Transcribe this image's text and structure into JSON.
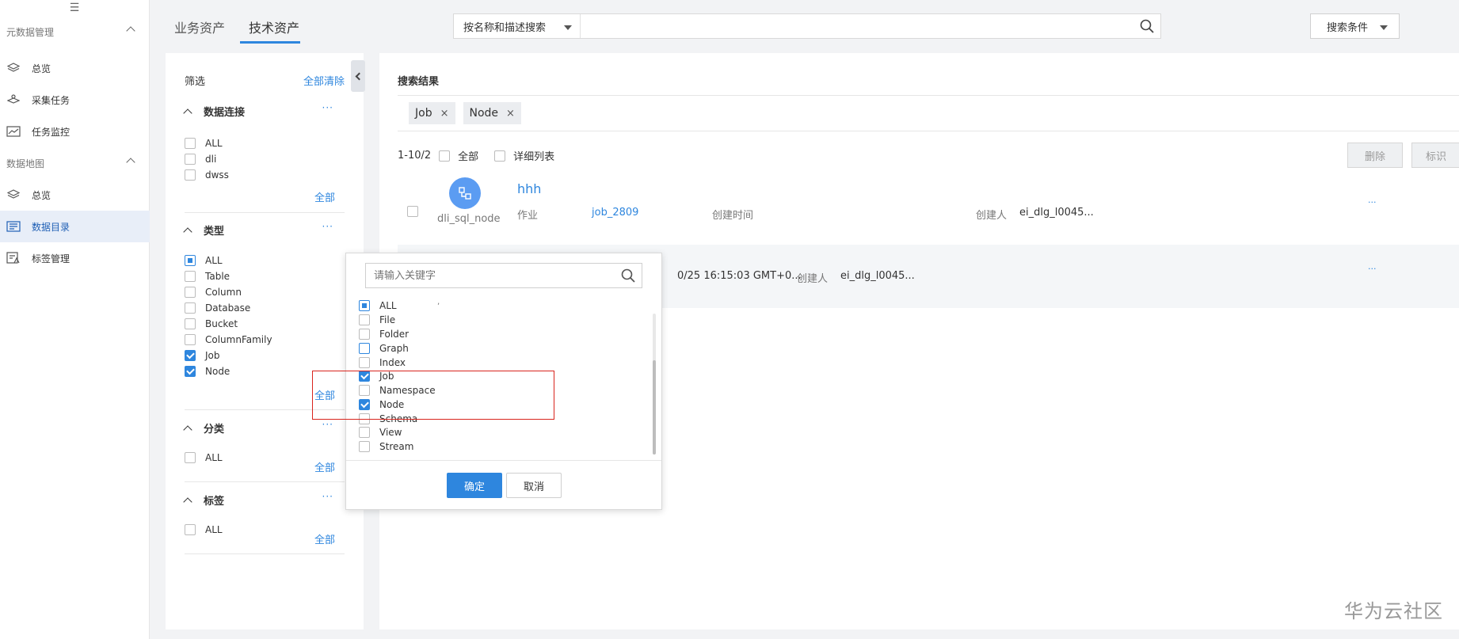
{
  "sidebar": {
    "groups": [
      {
        "label": "元数据管理",
        "items": [
          {
            "label": "总览",
            "icon": "layers-icon"
          },
          {
            "label": "采集任务",
            "icon": "collect-icon"
          },
          {
            "label": "任务监控",
            "icon": "chart-line-icon"
          }
        ]
      },
      {
        "label": "数据地图",
        "items": [
          {
            "label": "总览",
            "icon": "layers-icon"
          },
          {
            "label": "数据目录",
            "icon": "catalog-icon",
            "active": true
          },
          {
            "label": "标签管理",
            "icon": "tag-manage-icon"
          }
        ]
      }
    ]
  },
  "header": {
    "tabs": [
      "业务资产",
      "技术资产"
    ],
    "active_tab": "技术资产",
    "search_mode": "按名称和描述搜索",
    "search_value": "",
    "cond_label": "搜索条件"
  },
  "filter": {
    "title": "筛选",
    "clear": "全部清除",
    "more": "···",
    "all_label": "全部",
    "sections": {
      "conn": {
        "title": "数据连接",
        "options": [
          "ALL",
          "dli",
          "dwss"
        ]
      },
      "type": {
        "title": "类型",
        "options": [
          "ALL",
          "Table",
          "Column",
          "Database",
          "Bucket",
          "ColumnFamily",
          "Job",
          "Node"
        ]
      },
      "cat": {
        "title": "分类",
        "options": [
          "ALL"
        ]
      },
      "tag": {
        "title": "标签",
        "options": [
          "ALL"
        ]
      }
    }
  },
  "results": {
    "title": "搜索结果",
    "tags": [
      "Job",
      "Node"
    ],
    "tag_close": "×",
    "range": "1-10/2",
    "select_all": "全部",
    "detail_list": "详细列表",
    "delete": "删除",
    "mark": "标识",
    "rows": [
      {
        "name": "hhh",
        "avatar_label": "dli_sql_node",
        "type": "作业",
        "job": "job_2809",
        "created_label": "创建时间",
        "creator_label": "创建人",
        "creator": "ei_dlg_l0045..."
      },
      {
        "created_time": "0/25 16:15:03 GMT+0...",
        "creator_label": "创建人",
        "creator": "ei_dlg_l0045..."
      }
    ],
    "more": "···",
    "tick": ","
  },
  "popup": {
    "placeholder": "请输入关键字",
    "items": [
      {
        "label": "ALL",
        "state": "partial"
      },
      {
        "label": "File",
        "state": "unchecked"
      },
      {
        "label": "Folder",
        "state": "unchecked"
      },
      {
        "label": "Graph",
        "state": "unchecked"
      },
      {
        "label": "Index",
        "state": "unchecked"
      },
      {
        "label": "Job",
        "state": "checked"
      },
      {
        "label": "Namespace",
        "state": "unchecked"
      },
      {
        "label": "Node",
        "state": "checked"
      },
      {
        "label": "Schema",
        "state": "unchecked"
      },
      {
        "label": "View",
        "state": "unchecked"
      },
      {
        "label": "Stream",
        "state": "unchecked"
      }
    ],
    "ok": "确定",
    "cancel": "取消"
  },
  "watermark": "华为云社区",
  "colors": {
    "accent": "#2e86de",
    "highlight": "#d9251d"
  }
}
